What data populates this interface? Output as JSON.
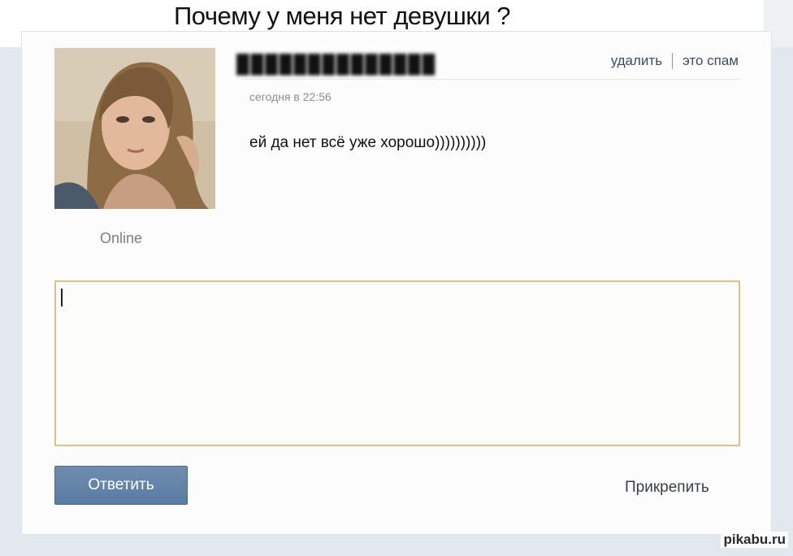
{
  "meme_title": "Почему у меня нет девушки ?",
  "author": {
    "name": "██████████████",
    "status": "Online",
    "avatar": "avatar-photo"
  },
  "message": {
    "timestamp": "сегодня в 22:56",
    "text": "ей да нет всё уже хорошо))))))))))"
  },
  "actions": {
    "delete_label": "удалить",
    "spam_label": "это спам"
  },
  "reply": {
    "value": "",
    "placeholder": "",
    "submit_label": "Ответить",
    "attach_label": "Прикрепить"
  },
  "watermark": "pikabu.ru",
  "colors": {
    "button": "#5f80a6",
    "input_border": "#d8c28a",
    "panel_bg": "#e3e8ee"
  }
}
